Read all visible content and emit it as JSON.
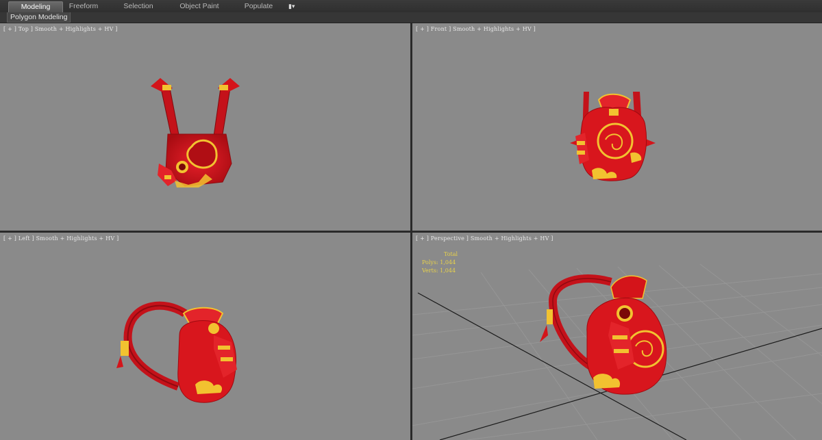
{
  "ribbon": {
    "tabs": [
      {
        "label": "Modeling",
        "active": true
      },
      {
        "label": "Freeform",
        "active": false
      },
      {
        "label": "Selection",
        "active": false
      },
      {
        "label": "Object Paint",
        "active": false
      },
      {
        "label": "Populate",
        "active": false
      }
    ],
    "extra_icon": "camera-dropdown-icon",
    "panel_label": "Polygon Modeling"
  },
  "viewports": {
    "top": {
      "label": "[ + ] Top ] Smooth + Highlights + HV ]"
    },
    "front": {
      "label": "[ + ] Front ] Smooth + Highlights + HV ]"
    },
    "left": {
      "label": "[ + ] Left ] Smooth + Highlights + HV ]"
    },
    "persp": {
      "label": "[ + ] Perspective ] Smooth + Highlights + HV ]",
      "stats": {
        "total": "Total",
        "polys": "Polys: 1,044",
        "verts": "Verts: 1,044"
      }
    }
  },
  "colors": {
    "viewport_bg": "#8a8a8a",
    "bag_red": "#d4141a",
    "gold": "#f2c230",
    "stats_yellow": "#e8d24a"
  }
}
